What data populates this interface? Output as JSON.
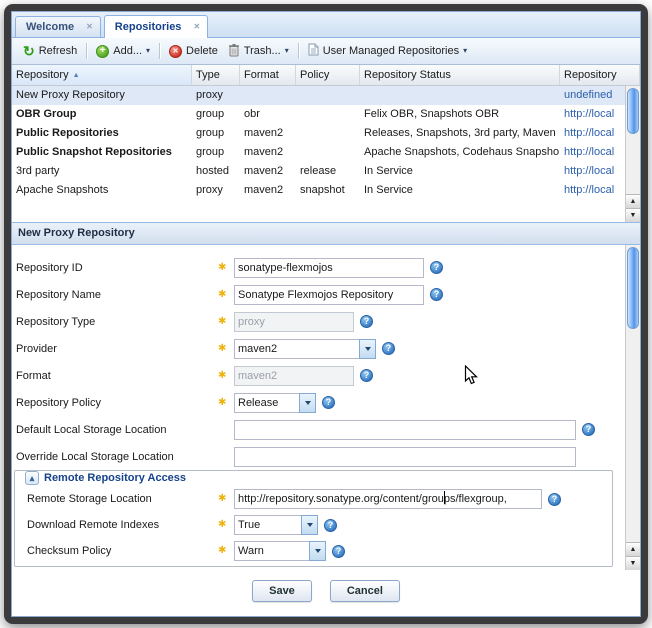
{
  "icons": {
    "close": "✕",
    "caret": "▾",
    "sort_asc": "▲",
    "plus": "+",
    "cross": "✕",
    "refresh": "↻",
    "help": "?",
    "star": "✱",
    "collapse": "▴",
    "scroll_up": "▲",
    "scroll_down": "▼"
  },
  "tabs": [
    {
      "label": "Welcome"
    },
    {
      "label": "Repositories"
    }
  ],
  "toolbar": {
    "refresh_label": "Refresh",
    "add_label": "Add...",
    "delete_label": "Delete",
    "trash_label": "Trash...",
    "user_managed_label": "User Managed Repositories"
  },
  "grid": {
    "columns": [
      "Repository",
      "Type",
      "Format",
      "Policy",
      "Repository Status",
      "Repository"
    ],
    "rows": [
      {
        "repository": "New Proxy Repository",
        "type": "proxy",
        "format": "",
        "policy": "",
        "status": "",
        "path": "undefined"
      },
      {
        "repository": "OBR Group",
        "type": "group",
        "format": "obr",
        "policy": "",
        "status": "Felix OBR, Snapshots OBR",
        "path": "http://local"
      },
      {
        "repository": "Public Repositories",
        "type": "group",
        "format": "maven2",
        "policy": "",
        "status": "Releases, Snapshots, 3rd party, Maven",
        "path": "http://local"
      },
      {
        "repository": "Public Snapshot Repositories",
        "type": "group",
        "format": "maven2",
        "policy": "",
        "status": "Apache Snapshots, Codehaus Snapsho",
        "path": "http://local"
      },
      {
        "repository": "3rd party",
        "type": "hosted",
        "format": "maven2",
        "policy": "release",
        "status": "In Service",
        "path": "http://local"
      },
      {
        "repository": "Apache Snapshots",
        "type": "proxy",
        "format": "maven2",
        "policy": "snapshot",
        "status": "In Service",
        "path": "http://local"
      }
    ]
  },
  "panel": {
    "title": "New Proxy Repository"
  },
  "form": {
    "fields": [
      {
        "label": "Repository ID",
        "value": "sonatype-flexmojos"
      },
      {
        "label": "Repository Name",
        "value": "Sonatype Flexmojos Repository"
      },
      {
        "label": "Repository Type",
        "value": "proxy"
      },
      {
        "label": "Provider",
        "value": "maven2"
      },
      {
        "label": "Format",
        "value": "maven2"
      },
      {
        "label": "Repository Policy",
        "value": "Release"
      },
      {
        "label": "Default Local Storage Location",
        "value": ""
      },
      {
        "label": "Override Local Storage Location",
        "value": ""
      }
    ],
    "fieldset": {
      "title": "Remote Repository Access",
      "fields": [
        {
          "label": "Remote Storage Location",
          "value": "http://repository.sonatype.org/content/groups/flexgroup,"
        },
        {
          "label": "Download Remote Indexes",
          "value": "True"
        },
        {
          "label": "Checksum Policy",
          "value": "Warn"
        }
      ]
    },
    "buttons": {
      "save": "Save",
      "cancel": "Cancel"
    }
  }
}
